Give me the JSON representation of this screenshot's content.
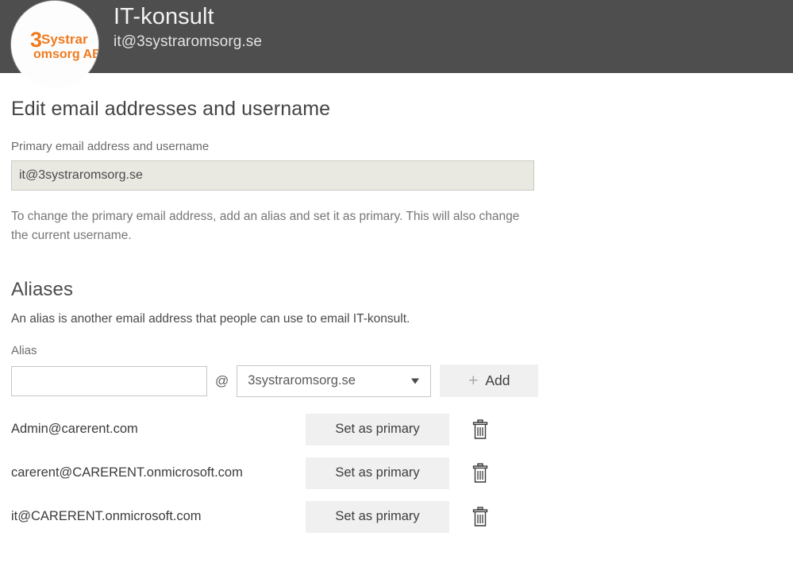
{
  "header": {
    "avatar": {
      "icon": "company-logo",
      "logo_digit": "3",
      "logo_line1": "Systrar",
      "logo_line2": "omsorg AB",
      "logo_color": "#f07a1e"
    },
    "title": "IT-konsult",
    "subtitle": "it@3systraromsorg.se",
    "background_color": "#4e4e4e"
  },
  "main": {
    "page_title": "Edit email addresses and username",
    "primary": {
      "label": "Primary email address and username",
      "value": "it@3systraromsorg.se",
      "help_text": "To change the primary email address, add an alias and set it as primary. This will also change the current username."
    },
    "aliases": {
      "section_title": "Aliases",
      "description": "An alias is another email address that people can use to email IT-konsult.",
      "field_label": "Alias",
      "alias_input_value": "",
      "alias_input_placeholder": "",
      "at_symbol": "@",
      "domain_selected": "3systraromsorg.se",
      "domain_options": [
        "3systraromsorg.se"
      ],
      "chevron_icon": "chevron-down-icon",
      "add_plus_icon": "+",
      "add_label": "Add",
      "set_primary_label": "Set as primary",
      "delete_icon": "trash-icon",
      "items": [
        {
          "email": "Admin@carerent.com"
        },
        {
          "email": "carerent@CARERENT.onmicrosoft.com"
        },
        {
          "email": "it@CARERENT.onmicrosoft.com"
        }
      ]
    }
  }
}
